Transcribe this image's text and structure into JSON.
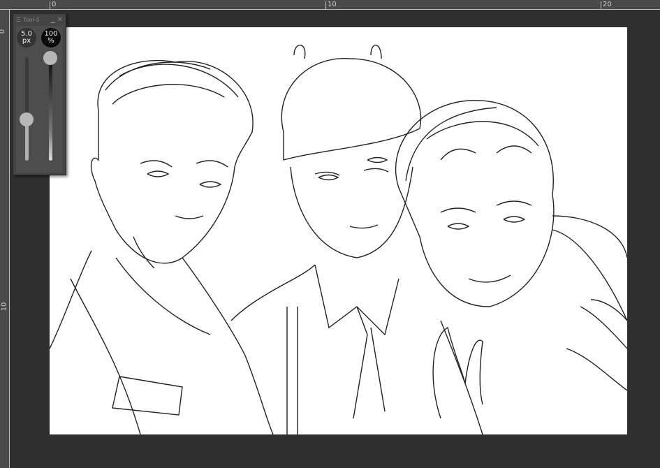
{
  "ruler": {
    "top_labels": [
      "0",
      "10",
      "20"
    ],
    "left_labels": [
      "0",
      "10"
    ]
  },
  "tool_panel": {
    "title": "Tool-S",
    "menu_icon": "hamburger-icon",
    "minimize_icon": "minimize-icon",
    "close_icon": "close-icon",
    "brush_size": {
      "value": "5.0",
      "unit": "px",
      "level": 0.35
    },
    "opacity": {
      "value": "100",
      "unit": "%",
      "level": 1.0
    }
  },
  "canvas": {
    "content": "line-art illustration of three men taking a selfie"
  }
}
